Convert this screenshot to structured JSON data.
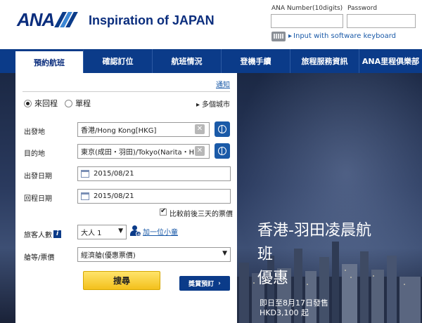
{
  "header": {
    "logo_text": "ANA",
    "tagline": "Inspiration of JAPAN",
    "ana_number_label": "ANA Number(10digits)",
    "password_label": "Password",
    "keyboard_link": "Input with software keyboard"
  },
  "nav": {
    "tabs": [
      {
        "label": "預約航班",
        "active": true
      },
      {
        "label": "確認訂位",
        "active": false
      },
      {
        "label": "航班情況",
        "active": false
      },
      {
        "label": "登機手續",
        "active": false
      },
      {
        "label": "旅程服務資訊",
        "active": false
      },
      {
        "label": "ANA里程俱樂部",
        "active": false
      }
    ]
  },
  "booking": {
    "notice_link": "通知",
    "trip_types": [
      "來回程",
      "單程"
    ],
    "selected_trip_type": "來回程",
    "multi_city": "多個城市",
    "origin_label": "出發地",
    "origin_value": "香港/Hong Kong[HKG]",
    "destination_label": "目的地",
    "destination_value": "東京(成田・羽田)/Tokyo(Narita・H···",
    "depart_label": "出發日期",
    "depart_value": "2015/08/21",
    "return_label": "回程日期",
    "return_value": "2015/08/21",
    "compare_checkbox_label": "比較前後三天的票價",
    "passengers_label": "旅客人數",
    "passengers_value": "大人 1",
    "add_child": "加一位小童",
    "cabin_label": "艙等/票價",
    "cabin_value": "經濟艙(優惠票價)",
    "search_button": "搜尋",
    "award_button": "獎賞預訂"
  },
  "promo": {
    "title_line1": "香港-羽田凌晨航",
    "title_line2": "班",
    "title_line3": "優惠",
    "subtitle_line1": "即日至8月17日發售",
    "subtitle_line2": "HKD3,100 起"
  },
  "colors": {
    "brand_blue": "#0a2d7d",
    "nav_blue": "#0b3b89",
    "search_yellow": "#f3c01c"
  }
}
